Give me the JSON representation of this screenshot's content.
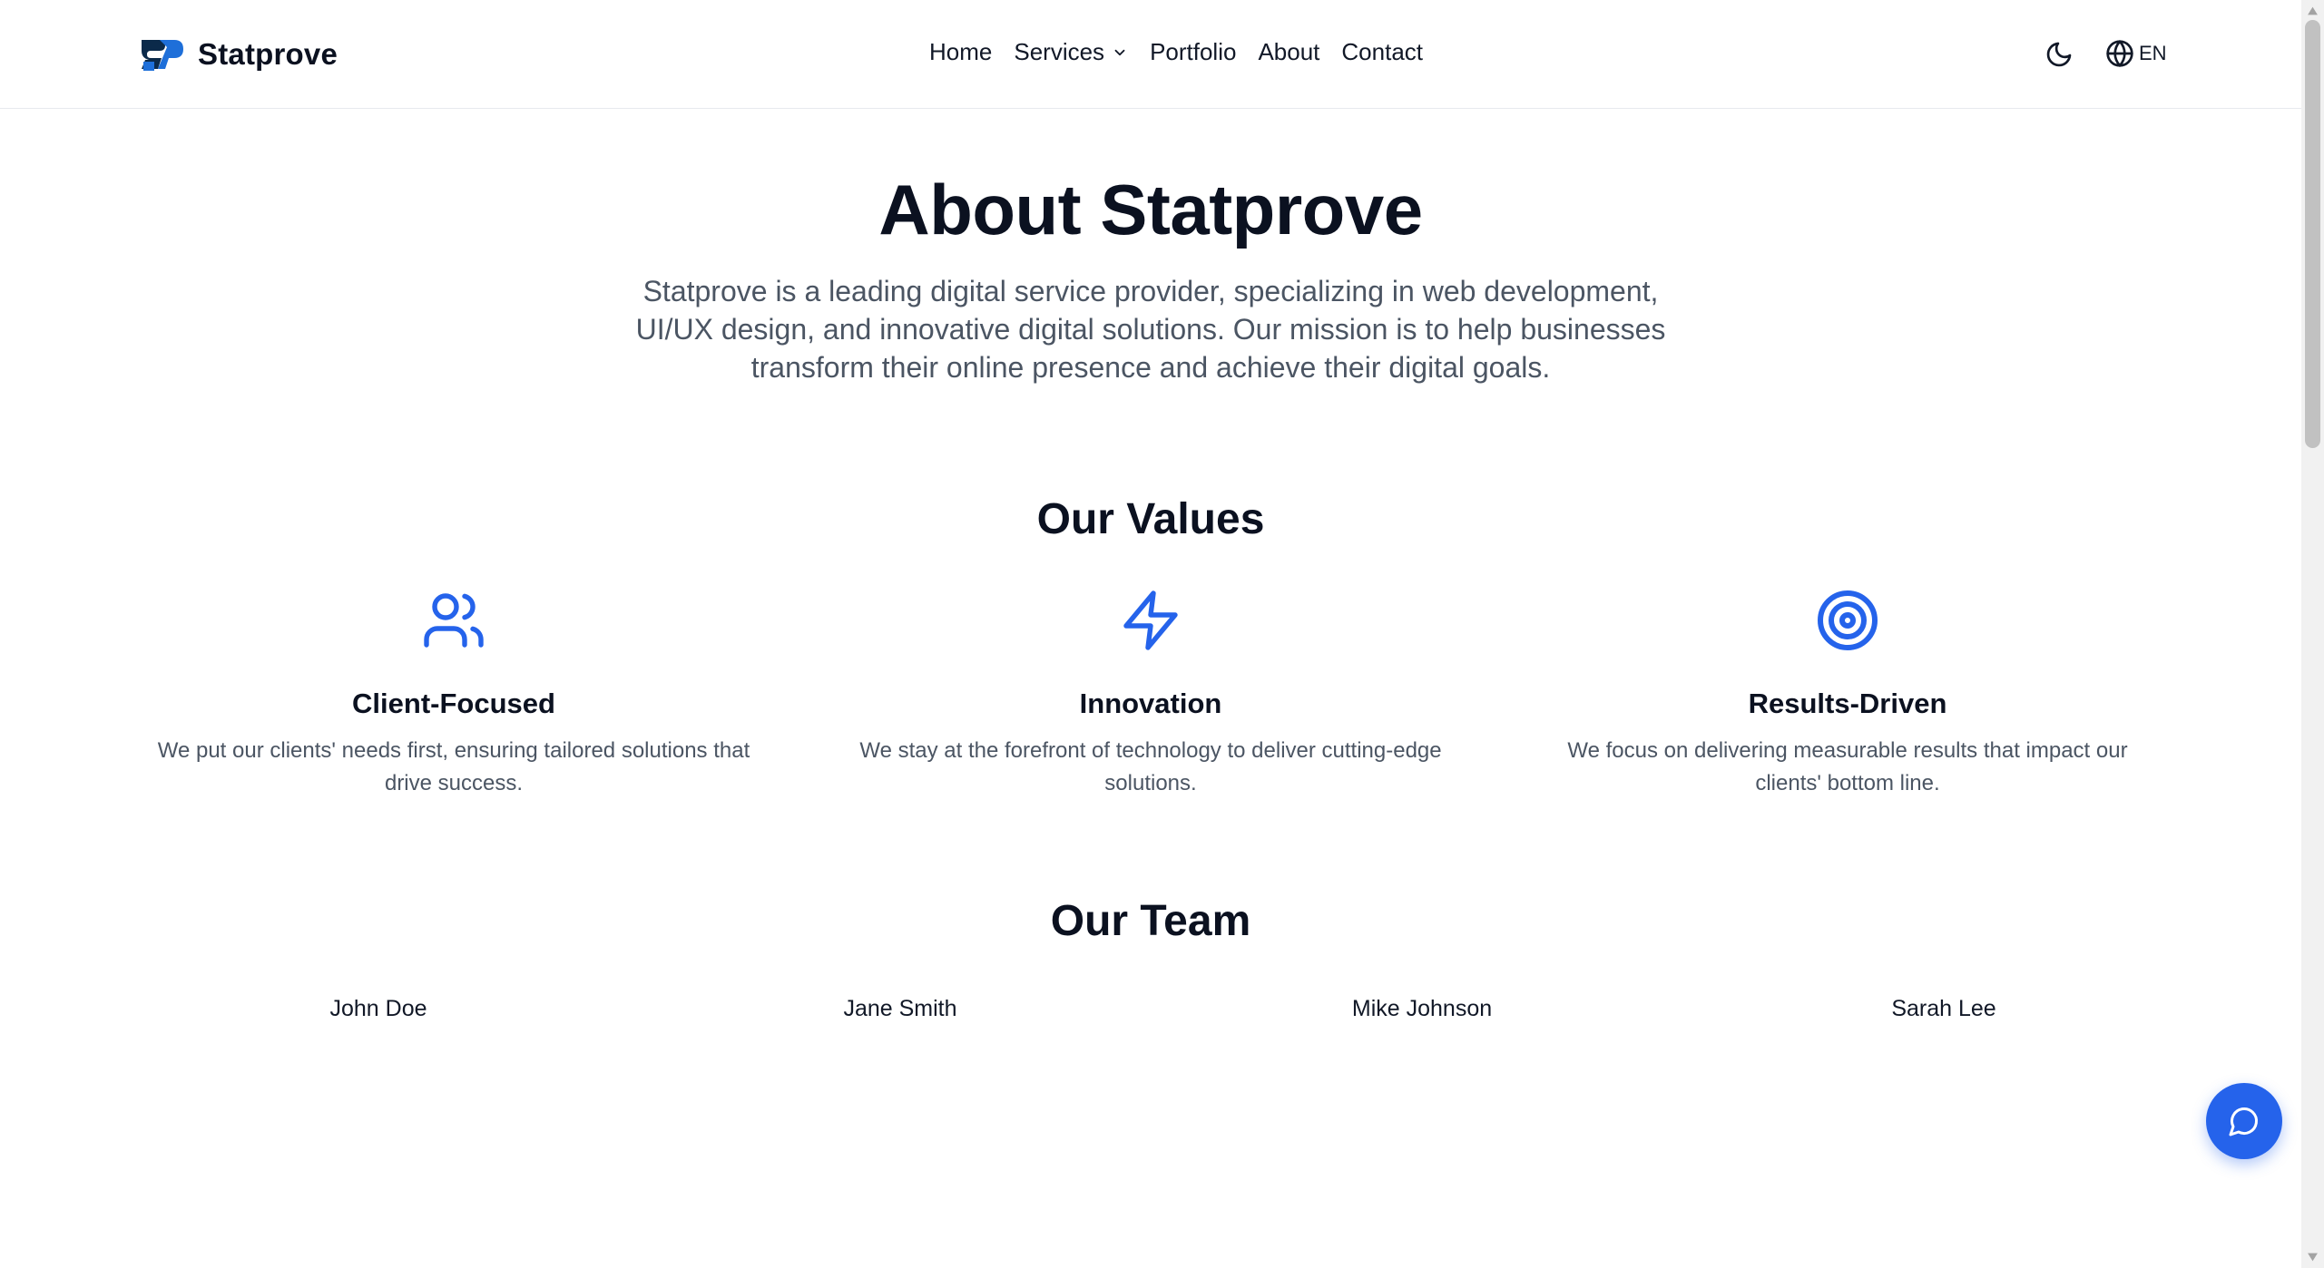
{
  "brand": {
    "name": "Statprove",
    "primary_color": "#2563eb",
    "dark_color": "#0b1120"
  },
  "nav": {
    "items": [
      {
        "label": "Home"
      },
      {
        "label": "Services",
        "has_dropdown": true
      },
      {
        "label": "Portfolio"
      },
      {
        "label": "About"
      },
      {
        "label": "Contact"
      }
    ],
    "theme_icon": "moon-icon",
    "language": {
      "icon": "globe-icon",
      "label": "EN"
    }
  },
  "hero": {
    "title": "About Statprove",
    "text": "Statprove is a leading digital service provider, specializing in web development, UI/UX design, and innovative digital solutions. Our mission is to help businesses transform their online presence and achieve their digital goals."
  },
  "values": {
    "title": "Our Values",
    "items": [
      {
        "icon": "users-icon",
        "title": "Client-Focused",
        "text": "We put our clients' needs first, ensuring tailored solutions that drive success."
      },
      {
        "icon": "zap-icon",
        "title": "Innovation",
        "text": "We stay at the forefront of technology to deliver cutting-edge solutions."
      },
      {
        "icon": "target-icon",
        "title": "Results-Driven",
        "text": "We focus on delivering measurable results that impact our clients' bottom line."
      }
    ]
  },
  "team": {
    "title": "Our Team",
    "members": [
      {
        "name": "John Doe"
      },
      {
        "name": "Jane Smith"
      },
      {
        "name": "Mike Johnson"
      },
      {
        "name": "Sarah Lee"
      }
    ]
  },
  "chat": {
    "icon": "chat-bubble-icon"
  }
}
